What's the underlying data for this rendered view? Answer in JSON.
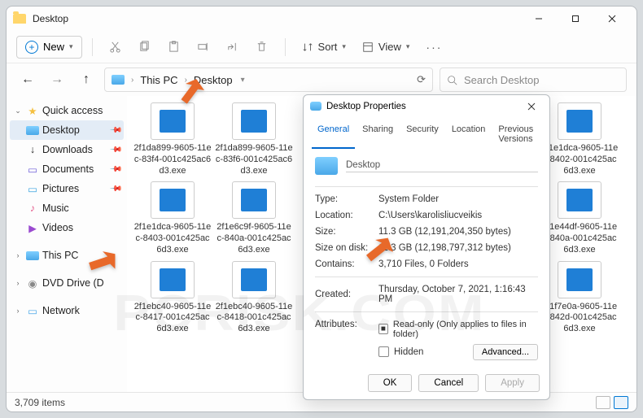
{
  "titlebar": {
    "title": "Desktop"
  },
  "toolbar": {
    "new_label": "New",
    "sort_label": "Sort",
    "view_label": "View"
  },
  "breadcrumb": {
    "crumb1": "This PC",
    "crumb2": "Desktop"
  },
  "search": {
    "placeholder": "Search Desktop"
  },
  "sidebar": {
    "quick": "Quick access",
    "desktop": "Desktop",
    "downloads": "Downloads",
    "documents": "Documents",
    "pictures": "Pictures",
    "music": "Music",
    "videos": "Videos",
    "this_pc": "This PC",
    "dvd": "DVD Drive (D",
    "network": "Network"
  },
  "files": [
    "2f1da899-9605-11ec-83f4-001c425ac6d3.exe",
    "2f1da899-9605-11ec-83f6-001c425ac6d3.exe",
    "",
    "",
    "",
    "2f1e1dca-9605-11ec-8402-001c425ac6d3.exe",
    "2f1e1dca-9605-11ec-8403-001c425ac6d3.exe",
    "2f1e6c9f-9605-11ec-840a-001c425ac6d3.exe",
    "",
    "",
    "",
    "2f1e44df-9605-11ec-840a-001c425ac6d3.exe",
    "2f1ebc40-9605-11ec-8417-001c425ac6d3.exe",
    "2f1ebc40-9605-11ec-8418-001c425ac6d3.exe",
    "",
    "",
    "",
    "2f1f7e0a-9605-11ec-842d-001c425ac6d3.exe"
  ],
  "statusbar": {
    "count": "3,709 items"
  },
  "props": {
    "title": "Desktop Properties",
    "tabs": {
      "general": "General",
      "sharing": "Sharing",
      "security": "Security",
      "location": "Location",
      "previous": "Previous Versions"
    },
    "name": "Desktop",
    "rows": {
      "type_l": "Type:",
      "type_v": "System Folder",
      "loc_l": "Location:",
      "loc_v": "C:\\Users\\karolisliucveikis",
      "size_l": "Size:",
      "size_v": "11.3 GB (12,191,204,350 bytes)",
      "disk_l": "Size on disk:",
      "disk_v": "11.3 GB (12,198,797,312 bytes)",
      "cont_l": "Contains:",
      "cont_v": "3,710 Files, 0 Folders",
      "crt_l": "Created:",
      "crt_v": "Thursday, October 7, 2021, 1:16:43 PM",
      "attr_l": "Attributes:",
      "readonly": "Read-only (Only applies to files in folder)",
      "hidden": "Hidden",
      "advanced": "Advanced..."
    },
    "footer": {
      "ok": "OK",
      "cancel": "Cancel",
      "apply": "Apply"
    }
  },
  "icons": {
    "downloads_color": "#2aa05a",
    "documents_color": "#6a5bd8",
    "pictures_color": "#3aa4e0",
    "music_color": "#e45a8a",
    "videos_color": "#9a4ad0"
  }
}
